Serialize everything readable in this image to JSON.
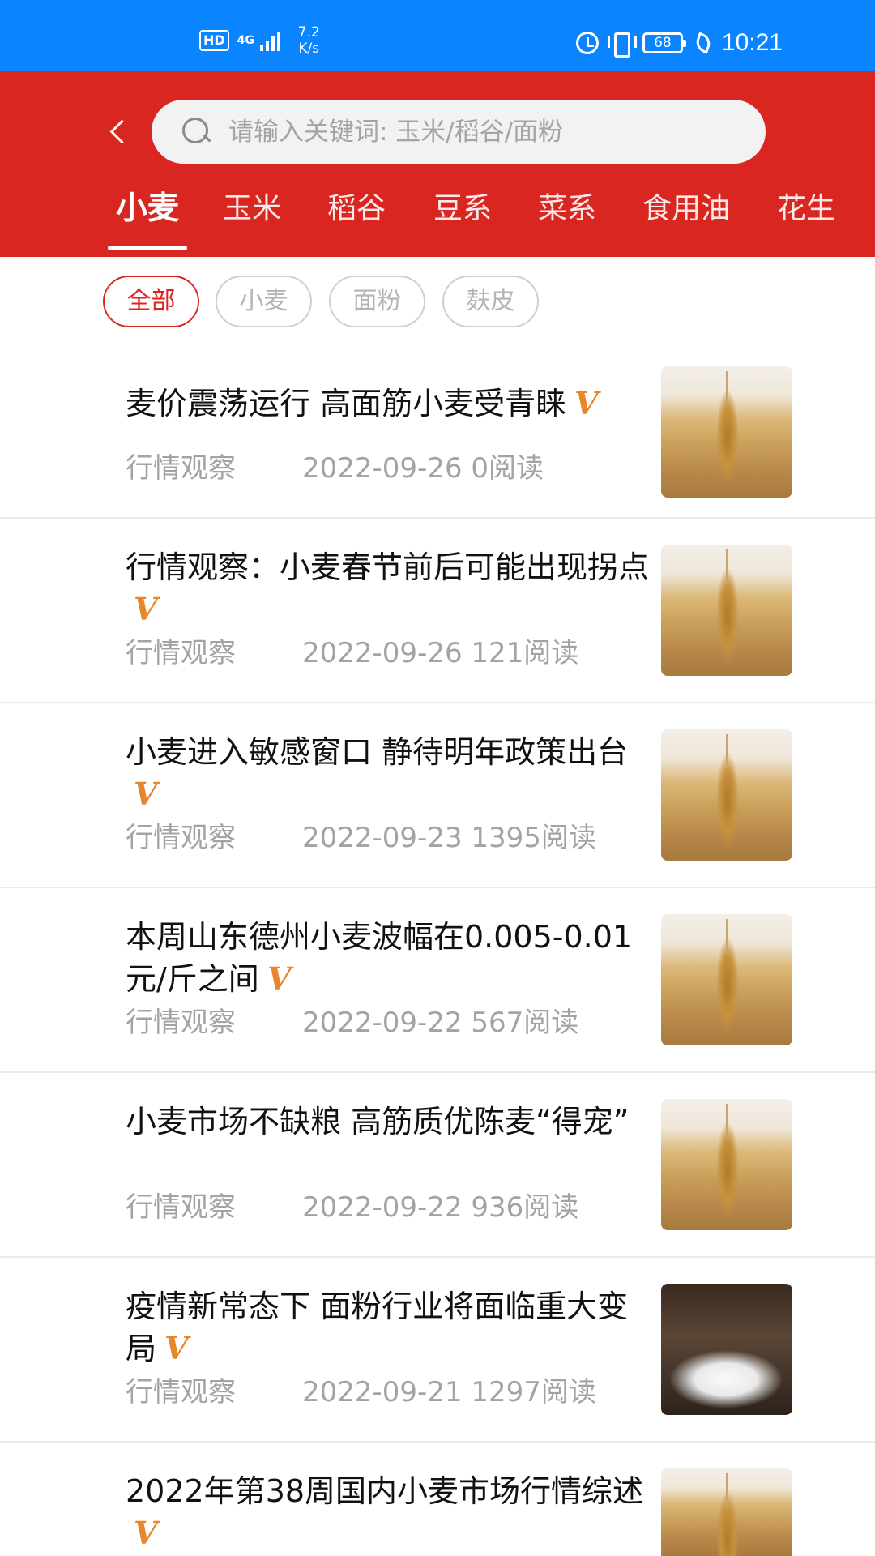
{
  "status_bar": {
    "hd": "HD",
    "network": "4G",
    "speed_value": "7.2",
    "speed_unit": "K/s",
    "battery": "68",
    "time": "10:21",
    "icons": [
      "alarm-icon",
      "vibrate-icon",
      "battery-icon",
      "leaf-icon"
    ]
  },
  "header": {
    "background_color": "#d92620",
    "search": {
      "placeholder": "请输入关键词: 玉米/稻谷/面粉",
      "value": ""
    },
    "tabs": [
      {
        "label": "小麦",
        "active": true
      },
      {
        "label": "玉米",
        "active": false
      },
      {
        "label": "稻谷",
        "active": false
      },
      {
        "label": "豆系",
        "active": false
      },
      {
        "label": "菜系",
        "active": false
      },
      {
        "label": "食用油",
        "active": false
      },
      {
        "label": "花生",
        "active": false
      }
    ]
  },
  "filters": [
    {
      "label": "全部",
      "active": true
    },
    {
      "label": "小麦",
      "active": false
    },
    {
      "label": "面粉",
      "active": false
    },
    {
      "label": "麸皮",
      "active": false
    }
  ],
  "articles": [
    {
      "title": "麦价震荡运行 高面筋小麦受青睐",
      "verified": "V",
      "source": "行情观察",
      "date": "2022-09-26",
      "reads": "0阅读",
      "thumb": "wheat"
    },
    {
      "title": "行情观察：小麦春节前后可能出现拐点",
      "verified": "V",
      "source": "行情观察",
      "date": "2022-09-26",
      "reads": "121阅读",
      "thumb": "wheat"
    },
    {
      "title": "小麦进入敏感窗口 静待明年政策出台",
      "verified": "V",
      "source": "行情观察",
      "date": "2022-09-23",
      "reads": "1395阅读",
      "thumb": "wheat"
    },
    {
      "title": "本周山东德州小麦波幅在0.005-0.01元/斤之间",
      "verified": "V",
      "source": "行情观察",
      "date": "2022-09-22",
      "reads": "567阅读",
      "thumb": "wheat"
    },
    {
      "title": "小麦市场不缺粮 高筋质优陈麦“得宠”",
      "verified": "",
      "source": "行情观察",
      "date": "2022-09-22",
      "reads": "936阅读",
      "thumb": "wheat"
    },
    {
      "title": "疫情新常态下 面粉行业将面临重大变局",
      "verified": "V",
      "source": "行情观察",
      "date": "2022-09-21",
      "reads": "1297阅读",
      "thumb": "flour"
    },
    {
      "title": "2022年第38周国内小麦市场行情综述",
      "verified": "V",
      "source": "",
      "date": "",
      "reads": "",
      "thumb": "wheat"
    }
  ]
}
